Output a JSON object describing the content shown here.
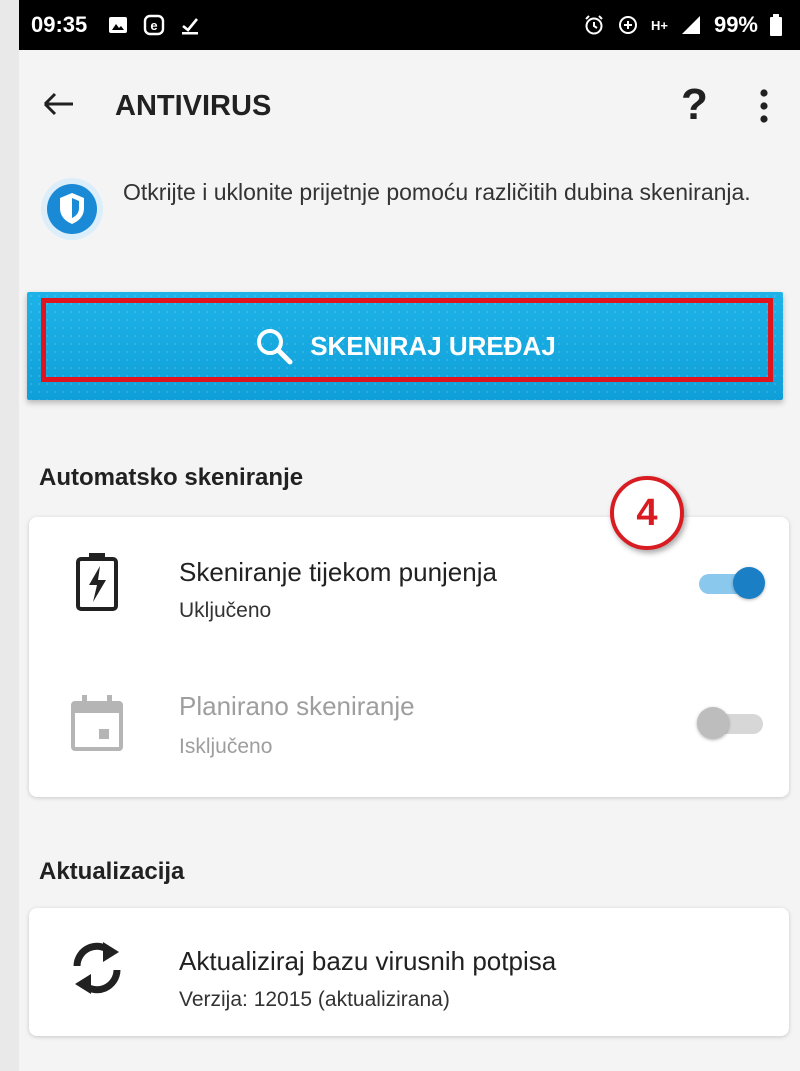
{
  "status_bar": {
    "time": "09:35",
    "battery": "99%",
    "signal_label": "H+"
  },
  "app_bar": {
    "title": "ANTIVIRUS",
    "help_label": "?"
  },
  "intro": {
    "text": "Otkrijte i uklonite prijetnje pomoću različitih dubina skeniranja."
  },
  "scan_button": {
    "label": "SKENIRAJ UREĐAJ"
  },
  "auto_scan": {
    "section_title": "Automatsko skeniranje",
    "items": [
      {
        "title": "Skeniranje tijekom punjenja",
        "status": "Uključeno",
        "enabled": true,
        "icon": "battery-charging-icon"
      },
      {
        "title": "Planirano skeniranje",
        "status": "Isključeno",
        "enabled": false,
        "icon": "calendar-icon"
      }
    ]
  },
  "annotation": {
    "label": "4"
  },
  "update": {
    "section_title": "Aktualizacija",
    "title": "Aktualiziraj bazu virusnih potpisa",
    "version": "Verzija: 12015 (aktualizirana)",
    "icon": "sync-icon"
  },
  "colors": {
    "accent": "#1ea9e1",
    "toggle_on": "#1a7fc4",
    "annotation_red": "#d81c22"
  }
}
